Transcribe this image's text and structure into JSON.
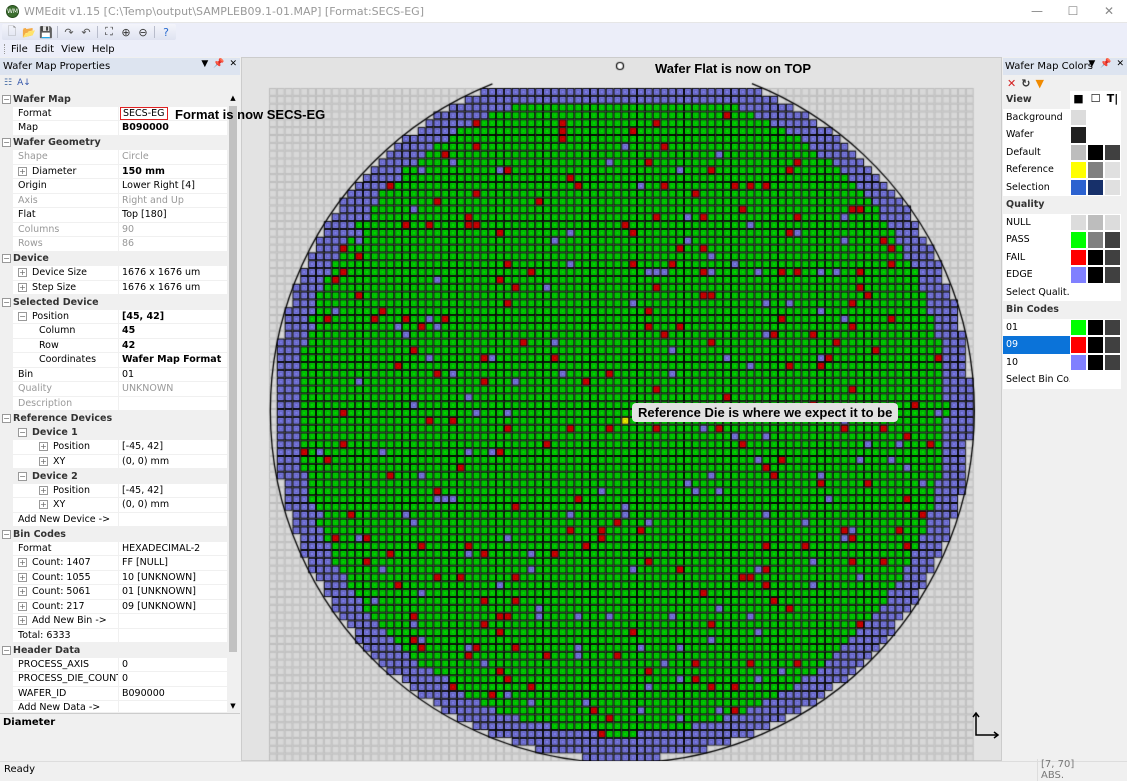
{
  "window": {
    "title": "WMEdit v1.15 [C:\\Temp\\output\\SAMPLEB09.1-01.MAP] [Format:SECS-EG]",
    "app_icon": "WM",
    "minimize": "—",
    "maximize": "☐",
    "close": "✕"
  },
  "toolbar": {
    "buttons": [
      {
        "name": "new-file-icon",
        "glyph": "🗋",
        "color": "#888"
      },
      {
        "name": "open-folder-icon",
        "glyph": "📂",
        "color": "#d9a020"
      },
      {
        "name": "save-icon",
        "glyph": "💾",
        "color": "#2a4fa0"
      },
      {
        "name": "redo-icon",
        "glyph": "↷",
        "color": "#555"
      },
      {
        "name": "undo-icon",
        "glyph": "↶",
        "color": "#555"
      },
      {
        "name": "fit-icon",
        "glyph": "⛶",
        "color": "#333"
      },
      {
        "name": "zoom-in-icon",
        "glyph": "⊕",
        "color": "#333"
      },
      {
        "name": "zoom-out-icon",
        "glyph": "⊖",
        "color": "#333"
      },
      {
        "name": "help-icon",
        "glyph": "?",
        "color": "#2b6cd0"
      }
    ]
  },
  "menu": [
    "File",
    "Edit",
    "View",
    "Help"
  ],
  "properties": {
    "title": "Wafer Map Properties",
    "sort_icons": [
      "categorized-icon",
      "alphabetical-sort-icon"
    ],
    "rows": [
      {
        "type": "cat",
        "name": "Wafer Map"
      },
      {
        "type": "prop",
        "name": "Format",
        "value": "SECS-EG",
        "boxed": true
      },
      {
        "type": "prop",
        "name": "Map",
        "value": "B090000",
        "bold": true
      },
      {
        "type": "cat",
        "name": "Wafer Geometry"
      },
      {
        "type": "prop",
        "name": "Shape",
        "value": "Circle",
        "grey": true
      },
      {
        "type": "prop",
        "name": "Diameter",
        "value": "150 mm",
        "bold": true,
        "expand": "+"
      },
      {
        "type": "prop",
        "name": "Origin",
        "value": "Lower Right [4]"
      },
      {
        "type": "prop",
        "name": "Axis",
        "value": "Right and Up",
        "grey": true
      },
      {
        "type": "prop",
        "name": "Flat",
        "value": "Top [180]"
      },
      {
        "type": "prop",
        "name": "Columns",
        "value": "90",
        "grey": true
      },
      {
        "type": "prop",
        "name": "Rows",
        "value": "86",
        "grey": true
      },
      {
        "type": "cat",
        "name": "Device"
      },
      {
        "type": "prop",
        "name": "Device Size",
        "value": "1676 x 1676 um",
        "expand": "+"
      },
      {
        "type": "prop",
        "name": "Step Size",
        "value": "1676 x 1676 um",
        "expand": "+"
      },
      {
        "type": "cat",
        "name": "Selected Device"
      },
      {
        "type": "prop",
        "name": "Position",
        "value": "[45, 42]",
        "bold": true,
        "expand": "−"
      },
      {
        "type": "sub",
        "name": "Column",
        "value": "45",
        "bold": true
      },
      {
        "type": "sub",
        "name": "Row",
        "value": "42",
        "bold": true
      },
      {
        "type": "sub",
        "name": "Coordinates",
        "value": "Wafer Map Format",
        "bold": true
      },
      {
        "type": "prop",
        "name": "Bin",
        "value": "01"
      },
      {
        "type": "prop",
        "name": "Quality",
        "value": "UNKNOWN",
        "grey": true
      },
      {
        "type": "prop",
        "name": "Description",
        "value": "",
        "grey": true
      },
      {
        "type": "cat",
        "name": "Reference Devices"
      },
      {
        "type": "group",
        "name": "Device 1",
        "expand": "−"
      },
      {
        "type": "sub2",
        "name": "Position",
        "value": "[-45, 42]",
        "expand": "+"
      },
      {
        "type": "sub2",
        "name": "XY",
        "value": "(0, 0) mm",
        "expand": "+"
      },
      {
        "type": "group",
        "name": "Device 2",
        "expand": "−"
      },
      {
        "type": "sub2",
        "name": "Position",
        "value": "[-45, 42]",
        "expand": "+"
      },
      {
        "type": "sub2",
        "name": "XY",
        "value": "(0, 0) mm",
        "expand": "+"
      },
      {
        "type": "prop",
        "name": "Add New Device ->",
        "value": ""
      },
      {
        "type": "cat",
        "name": "Bin Codes"
      },
      {
        "type": "prop",
        "name": "Format",
        "value": "HEXADECIMAL-2"
      },
      {
        "type": "prop",
        "name": "Count: 1407",
        "value": "FF [NULL]",
        "expand": "+"
      },
      {
        "type": "prop",
        "name": "Count: 1055",
        "value": "10 [UNKNOWN]",
        "expand": "+"
      },
      {
        "type": "prop",
        "name": "Count: 5061",
        "value": "01 [UNKNOWN]",
        "expand": "+"
      },
      {
        "type": "prop",
        "name": "Count: 217",
        "value": "09 [UNKNOWN]",
        "expand": "+"
      },
      {
        "type": "prop",
        "name": "Add New Bin ->",
        "value": "",
        "expand": "+"
      },
      {
        "type": "prop",
        "name": "Total: 6333",
        "value": ""
      },
      {
        "type": "cat",
        "name": "Header Data"
      },
      {
        "type": "prop",
        "name": "PROCESS_AXIS",
        "value": "0"
      },
      {
        "type": "prop",
        "name": "PROCESS_DIE_COUNT",
        "value": "0"
      },
      {
        "type": "prop",
        "name": "WAFER_ID",
        "value": "B090000"
      },
      {
        "type": "prop",
        "name": "Add New Data ->",
        "value": ""
      }
    ],
    "description_title": "Diameter"
  },
  "wafer_map": {
    "columns": 90,
    "rows": 86,
    "flat": "Top",
    "reference_die": [
      45,
      42
    ],
    "bin_counts": {
      "FF": 1407,
      "10": 1055,
      "01": 5061,
      "09": 217
    },
    "annotations": {
      "format": "Format is now SECS-EG",
      "flat": "Wafer Flat is now on TOP",
      "reference": "Reference Die is where we expect it to be"
    }
  },
  "colors_panel": {
    "title": "Wafer Map Colors",
    "tools": [
      {
        "name": "delete-icon",
        "glyph": "✕",
        "color": "#d42020"
      },
      {
        "name": "reset-icon",
        "glyph": "↻",
        "color": "#333"
      },
      {
        "name": "filter-icon",
        "glyph": "▼",
        "color": "#f08a00"
      }
    ],
    "rows": [
      {
        "type": "sec",
        "label": "View",
        "header_icons": [
          "■",
          "☐",
          "T|"
        ]
      },
      {
        "label": "Background",
        "colors": [
          "#dcdcdc",
          "#ffffff",
          "#ffffff"
        ]
      },
      {
        "label": "Wafer",
        "colors": [
          "#202020",
          "#ffffff",
          "#ffffff"
        ]
      },
      {
        "label": "Default",
        "colors": [
          "#bdbdbd",
          "#000000",
          "#404040"
        ]
      },
      {
        "label": "Reference",
        "colors": [
          "#ffff00",
          "#808080",
          "#e0e0e0"
        ]
      },
      {
        "label": "Selection",
        "colors": [
          "#2c62d0",
          "#17306a",
          "#e0e0e0"
        ]
      },
      {
        "type": "sec",
        "label": "Quality"
      },
      {
        "label": "NULL",
        "colors": [
          "#dcdcdc",
          "#bdbdbd",
          "#dcdcdc"
        ]
      },
      {
        "label": "PASS",
        "colors": [
          "#00ff00",
          "#808080",
          "#404040"
        ]
      },
      {
        "label": "FAIL",
        "colors": [
          "#ff0000",
          "#000000",
          "#404040"
        ]
      },
      {
        "label": "EDGE",
        "colors": [
          "#8080ff",
          "#000000",
          "#404040"
        ]
      },
      {
        "label": "Select Qualit...",
        "colors": [
          "#ffffff",
          "#ffffff",
          "#ffffff"
        ]
      },
      {
        "type": "sec",
        "label": "Bin Codes"
      },
      {
        "label": "01",
        "colors": [
          "#00ff00",
          "#000000",
          "#404040"
        ]
      },
      {
        "label": "09",
        "colors": [
          "#ff0000",
          "#000000",
          "#404040"
        ],
        "selected": true
      },
      {
        "label": "10",
        "colors": [
          "#8080ff",
          "#000000",
          "#404040"
        ]
      },
      {
        "label": "Select Bin Co...",
        "colors": [
          "#ffffff",
          "#ffffff",
          "#ffffff"
        ]
      }
    ]
  },
  "status": {
    "text": "Ready",
    "coord": "[7, 70] ABS."
  },
  "theme": {
    "pass": "#00e000",
    "fail": "#e00000",
    "edge": "#8080f0",
    "null": "#d8d8d8",
    "reference": "#ffff00"
  }
}
